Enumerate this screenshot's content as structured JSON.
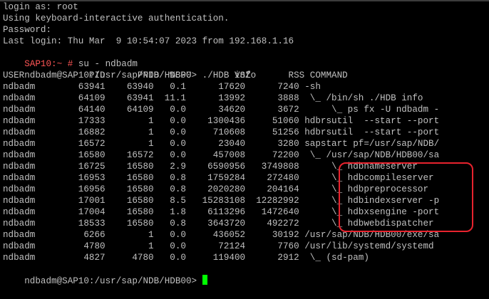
{
  "terminal": {
    "login_line": "login as: root",
    "auth_line": "Using keyboard-interactive authentication.",
    "password_line": "Password:",
    "last_login_line": "Last login: Thu Mar  9 10:54:07 2023 from 192.168.1.16",
    "root_prompt": "SAP10:~ #",
    "root_command": " su - ndbadm",
    "user_prompt": "ndbadm@SAP10:/usr/sap/NDB/HDB00>",
    "hdb_info_command": " ./HDB info",
    "header": "USER            PID      PPID  %CPU        VSZ       RSS COMMAND",
    "rows": [
      "ndbadm        63941    63940   0.1      17620      7240 -sh",
      "ndbadm        64109    63941  11.1      13992      3888  \\_ /bin/sh ./HDB info",
      "ndbadm        64140    64109   0.0      34620      3672      \\_ ps fx -U ndbadm -",
      "ndbadm        17333        1   0.0    1300436     51060 hdbrsutil  --start --port",
      "ndbadm        16882        1   0.0     710608     51256 hdbrsutil  --start --port",
      "ndbadm        16572        1   0.0      23040      3280 sapstart pf=/usr/sap/NDB/",
      "ndbadm        16580    16572   0.0     457008     72200  \\_ /usr/sap/NDB/HDB00/sa",
      "ndbadm        16725    16580   2.9    6590956   3749808      \\_ hdbnameserver",
      "ndbadm        16953    16580   0.8    1759284    272480      \\_ hdbcompileserver",
      "ndbadm        16956    16580   0.8    2020280    204164      \\_ hdbpreprocessor",
      "ndbadm        17001    16580   8.5   15283108  12282992      \\_ hdbindexserver -p",
      "ndbadm        17004    16580   1.8    6113296   1472640      \\_ hdbxsengine -port",
      "ndbadm        18533    16580   0.8    3643720    492272      \\_ hdbwebdispatcher",
      "ndbadm         6266        1   0.0     436052     30192 /usr/sap/NDB/HDB00/exe/sa",
      "ndbadm         4780        1   0.0      72124      7760 /usr/lib/systemd/systemd",
      "ndbadm         4827     4780   0.0     119400      2912  \\_ (sd-pam)"
    ],
    "final_prompt": "ndbadm@SAP10:/usr/sap/NDB/HDB00>"
  },
  "colors": {
    "background": "#000000",
    "text": "#c0c0c0",
    "root_prompt": "#ff5555",
    "cursor": "#00ff00",
    "highlight": "#e8232e"
  }
}
